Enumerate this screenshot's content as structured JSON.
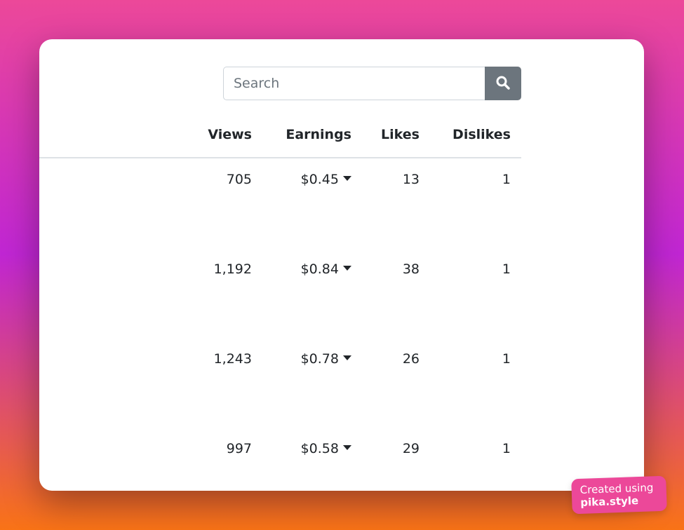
{
  "search": {
    "placeholder": "Search",
    "value": ""
  },
  "table": {
    "headers": {
      "views": "Views",
      "earnings": "Earnings",
      "likes": "Likes",
      "dislikes": "Dislikes"
    },
    "rows": [
      {
        "views": "705",
        "earnings": "$0.45",
        "likes": "13",
        "dislikes": "1"
      },
      {
        "views": "1,192",
        "earnings": "$0.84",
        "likes": "38",
        "dislikes": "1"
      },
      {
        "views": "1,243",
        "earnings": "$0.78",
        "likes": "26",
        "dislikes": "1"
      },
      {
        "views": "997",
        "earnings": "$0.58",
        "likes": "29",
        "dislikes": "1"
      }
    ]
  },
  "badge": {
    "line1": "Created using",
    "line2": "pika.style"
  },
  "colors": {
    "search_button": "#6c757d",
    "badge": "#ec4899",
    "gradient_top": "#ec4899",
    "gradient_mid": "#c026d3",
    "gradient_bottom": "#f97316"
  }
}
